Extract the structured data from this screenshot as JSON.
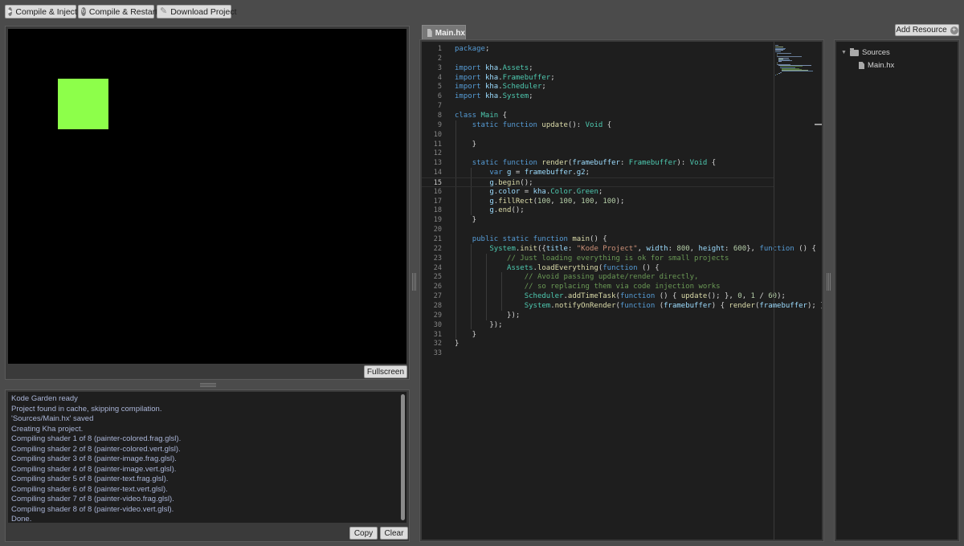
{
  "toolbar": {
    "compile_inject": "Compile & Inject",
    "compile_restart": "Compile & Restart",
    "download_project": "Download Project"
  },
  "preview": {
    "fullscreen_label": "Fullscreen",
    "rect_color": "#8dff4a",
    "canvas_color": "#000000"
  },
  "console": {
    "lines": [
      "Kode Garden ready",
      "Project found in cache, skipping compilation.",
      "'Sources/Main.hx' saved",
      "Creating Kha project.",
      "Compiling shader 1 of 8 (painter-colored.frag.glsl).",
      "Compiling shader 2 of 8 (painter-colored.vert.glsl).",
      "Compiling shader 3 of 8 (painter-image.frag.glsl).",
      "Compiling shader 4 of 8 (painter-image.vert.glsl).",
      "Compiling shader 5 of 8 (painter-text.frag.glsl).",
      "Compiling shader 6 of 8 (painter-text.vert.glsl).",
      "Compiling shader 7 of 8 (painter-video.frag.glsl).",
      "Compiling shader 8 of 8 (painter-video.vert.glsl).",
      "Done."
    ],
    "copy_label": "Copy",
    "clear_label": "Clear"
  },
  "editor": {
    "tab_label": "Main.hx",
    "current_line": 15,
    "lines": [
      "package;",
      "",
      "import kha.Assets;",
      "import kha.Framebuffer;",
      "import kha.Scheduler;",
      "import kha.System;",
      "",
      "class Main {",
      "    static function update(): Void {",
      "",
      "    }",
      "",
      "    static function render(framebuffer: Framebuffer): Void {",
      "        var g = framebuffer.g2;",
      "        g.begin();",
      "        g.color = kha.Color.Green;",
      "        g.fillRect(100, 100, 100, 100);",
      "        g.end();",
      "    }",
      "",
      "    public static function main() {",
      "        System.init({title: \"Kode Project\", width: 800, height: 600}, function () {",
      "            // Just loading everything is ok for small projects",
      "            Assets.loadEverything(function () {",
      "                // Avoid passing update/render directly,",
      "                // so replacing them via code injection works",
      "                Scheduler.addTimeTask(function () { update(); }, 0, 1 / 60);",
      "                System.notifyOnRender(function (framebuffer) { render(framebuffer); });",
      "            });",
      "        });",
      "    }",
      "}",
      ""
    ]
  },
  "resources": {
    "add_label": "Add Resource",
    "folder_label": "Sources",
    "file_label": "Main.hx"
  }
}
